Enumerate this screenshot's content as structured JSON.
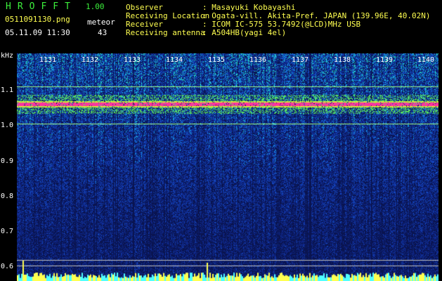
{
  "header": {
    "title": "HROFFT",
    "version": "1.00",
    "file_name": "0511091130.png",
    "datetime": "05.11.09 11:30",
    "meteor_label": "meteor",
    "meteor_count": "43"
  },
  "info": [
    {
      "label": "Observer",
      "value": ": Masayuki Kobayashi"
    },
    {
      "label": "Receiving Location",
      "value": ": Ogata-vill. Akita-Pref. JAPAN (139.96E, 40.02N)"
    },
    {
      "label": "Receiver",
      "value": ": ICOM IC-575 53.7492(@LCD)MHz USB"
    },
    {
      "label": "Receiving antenna",
      "value": ": A504HB(yagi 4el)"
    }
  ],
  "axis": {
    "y_unit": "kHz",
    "y_ticks": [
      "1.1",
      "1.0",
      "0.9",
      "0.8",
      "0.7",
      "0.6"
    ],
    "x_ticks": [
      "1131",
      "1132",
      "1133",
      "1134",
      "1135",
      "1136",
      "1137",
      "1138",
      "1139",
      "1140"
    ]
  },
  "colors": {
    "background": "#000000",
    "header_green": "#3cf03c",
    "header_yellow": "#ffff50",
    "noise_blue": "#1a3cb4",
    "signal_magenta": "#ff3caa",
    "guide_line": "#a0ff80"
  }
}
